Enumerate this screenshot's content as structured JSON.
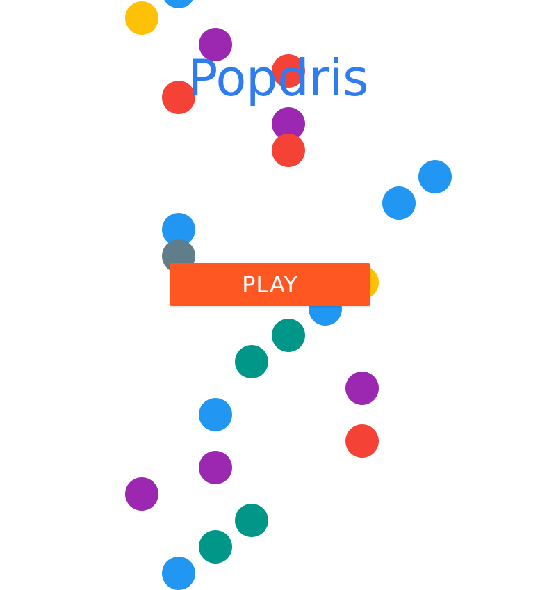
{
  "game": {
    "title": "Popdris",
    "play_label": "PLAY",
    "colors": {
      "title": "#2f7cf0",
      "play_button": "#ff5722",
      "yellow": "#ffc107",
      "blue": "#2196f3",
      "purple": "#9c27b0",
      "red": "#f44336",
      "teal": "#009688",
      "grey": "#607d8b"
    },
    "dots": [
      "yellow",
      "blue",
      "purple",
      "red",
      "red",
      "purple",
      "red",
      "blue",
      "blue",
      "blue",
      "grey",
      "yellow",
      "blue",
      "teal",
      "teal",
      "purple",
      "blue",
      "red",
      "purple",
      "purple",
      "teal",
      "teal",
      "blue"
    ]
  }
}
